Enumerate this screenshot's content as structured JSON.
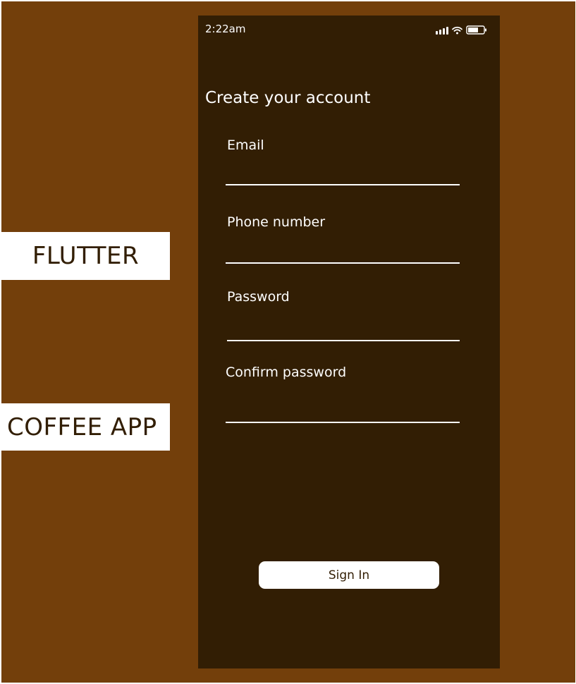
{
  "side_labels": {
    "flutter": "FLUTTER",
    "coffee_app": "COFFEE APP"
  },
  "status_bar": {
    "time": "2:22am",
    "icons": [
      "cellular-signal-icon",
      "wifi-icon",
      "battery-icon"
    ]
  },
  "form": {
    "title": "Create your account",
    "fields": [
      {
        "label": "Email",
        "value": ""
      },
      {
        "label": "Phone number",
        "value": ""
      },
      {
        "label": "Password",
        "value": ""
      },
      {
        "label": "Confirm password",
        "value": ""
      }
    ],
    "submit_label": "Sign In"
  },
  "colors": {
    "background": "#733f0b",
    "phone_background": "#321e04",
    "label_text": "#321e04",
    "button_background": "#ffffff",
    "text": "#ffffff"
  }
}
